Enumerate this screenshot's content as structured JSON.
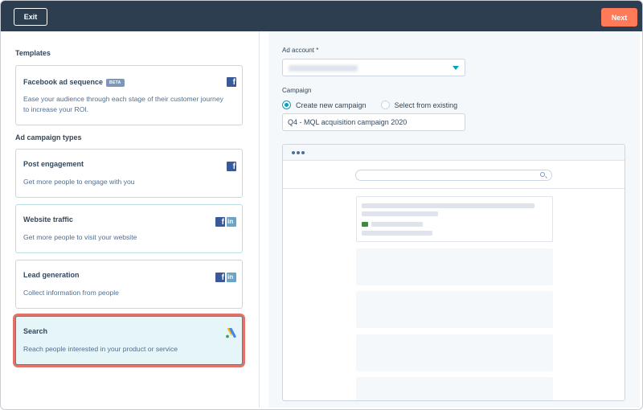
{
  "topbar": {
    "exit_label": "Exit",
    "next_label": "Next",
    "background": "#2d3e50",
    "accent": "#ff7a59"
  },
  "left": {
    "templates_title": "Templates",
    "templates": [
      {
        "title": "Facebook ad sequence",
        "badge": "BETA",
        "description": "Ease your audience through each stage of their customer journey to increase your ROI.",
        "icons": [
          "facebook-icon"
        ]
      }
    ],
    "types_title": "Ad campaign types",
    "types": [
      {
        "title": "Post engagement",
        "description": "Get more people to engage with you",
        "icons": [
          "facebook-icon"
        ],
        "selected": false
      },
      {
        "title": "Website traffic",
        "description": "Get more people to visit your website",
        "icons": [
          "facebook-icon",
          "linkedin-icon"
        ],
        "selected": false
      },
      {
        "title": "Lead generation",
        "description": "Collect information from people",
        "icons": [
          "facebook-icon",
          "linkedin-icon"
        ],
        "selected": false
      },
      {
        "title": "Search",
        "description": "Reach people interested in your product or service",
        "icons": [
          "google-ads-icon"
        ],
        "selected": true
      }
    ]
  },
  "right": {
    "ad_account_label": "Ad account *",
    "campaign_label": "Campaign",
    "radio_options": [
      {
        "label": "Create new campaign",
        "checked": true
      },
      {
        "label": "Select from existing",
        "checked": false
      }
    ],
    "campaign_name_value": "Q4 - MQL acquisition campaign 2020"
  },
  "icons": {
    "fb_glyph": "f",
    "li_glyph": "in"
  },
  "colors": {
    "selected_outline": "#e2736a",
    "teal": "#00a4bd",
    "facebook": "#3b5998",
    "linkedin": "#6aa4c8"
  }
}
